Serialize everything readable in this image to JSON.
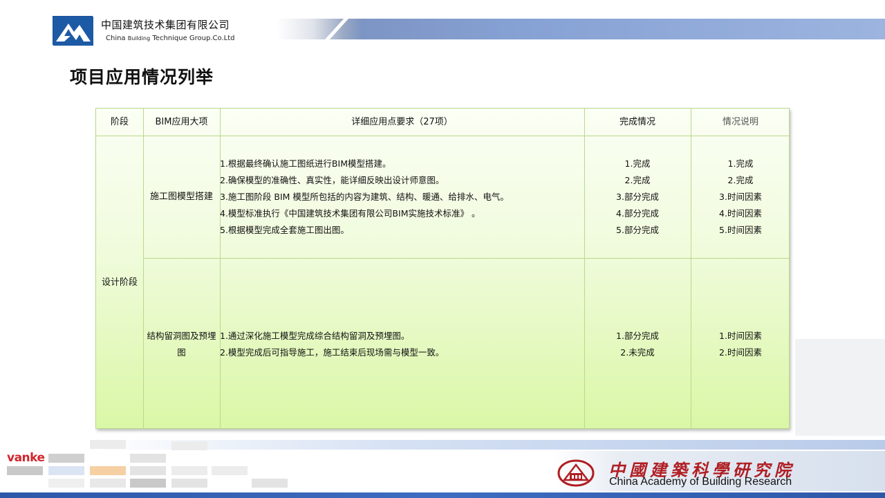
{
  "header": {
    "company_cn": "中国建筑技术集团有限公司",
    "company_en_part1": "China ",
    "company_en_small": "Building",
    "company_en_part2": " Technique Group.Co.Ltd"
  },
  "page_title": "项目应用情况列举",
  "table": {
    "headers": {
      "stage": "阶段",
      "category": "BIM应用大项",
      "details": "详细应用点要求（27项）",
      "status": "完成情况",
      "notes": "情况说明"
    },
    "stage": "设计阶段",
    "rows": [
      {
        "category": "施工图模型搭建",
        "details": [
          "1.根据最终确认施工图纸进行BIM模型搭建。",
          "2.确保模型的准确性、真实性，能详细反映出设计师意图。",
          "3.施工图阶段 BIM 模型所包括的内容为建筑、结构、暖通、给排水、电气。",
          "4.模型标准执行《中国建筑技术集团有限公司BIM实施技术标准》 。",
          "5.根据模型完成全套施工图出图。"
        ],
        "status": [
          "1.完成",
          "2.完成",
          "3.部分完成",
          "4.部分完成",
          "5.部分完成"
        ],
        "notes": [
          "1.完成",
          "2.完成",
          "3.时间因素",
          "4.时间因素",
          "5.时间因素"
        ]
      },
      {
        "category_line1": "结构留洞图及预埋",
        "category_line2": "图",
        "details": [
          "1.通过深化施工模型完成综合结构留洞及预埋图。",
          "2.模型完成后可指导施工，施工结束后现场需与模型一致。"
        ],
        "status": [
          "1.部分完成",
          "2.未完成"
        ],
        "notes": [
          "1.时间因素",
          "2.时间因素"
        ]
      }
    ]
  },
  "footer": {
    "vanke": "vanke",
    "cabr_cn": "中國建築科學研究院",
    "cabr_en": "China Academy of Building Research"
  },
  "colors": {
    "brand_blue": "#1d5aa6",
    "table_border": "#b9d98a",
    "table_green": "#daf7a6",
    "cabr_red": "#b01e23",
    "vanke_red": "#d0262d"
  }
}
